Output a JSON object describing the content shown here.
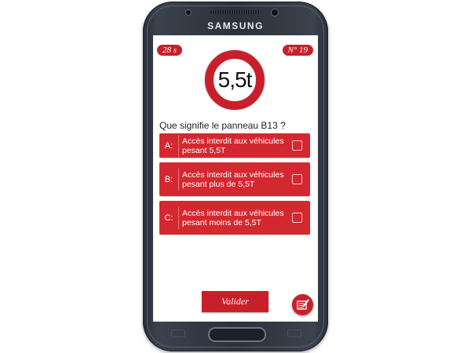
{
  "device": {
    "brand": "SAMSUNG"
  },
  "header": {
    "timer": "28 s",
    "question_number": "N° 19"
  },
  "sign": {
    "text": "5,5t"
  },
  "question": {
    "text": "Que signifie le panneau B13 ?"
  },
  "answers": [
    {
      "letter": "A:",
      "text": "Accès interdit aux véhicules pesant 5,5T"
    },
    {
      "letter": "B:",
      "text": "Accès interdit aux véhicules pesant plus de 5,5T"
    },
    {
      "letter": "C:",
      "text": "Accès interdit aux véhicules pesant moins de 5,5T"
    }
  ],
  "footer": {
    "validate_label": "Valider"
  },
  "icons": {
    "fab": "edit-notes-icon"
  },
  "colors": {
    "accent": "#c8202a",
    "answer_bg": "#d42830",
    "screen_bg": "#ffffff"
  }
}
